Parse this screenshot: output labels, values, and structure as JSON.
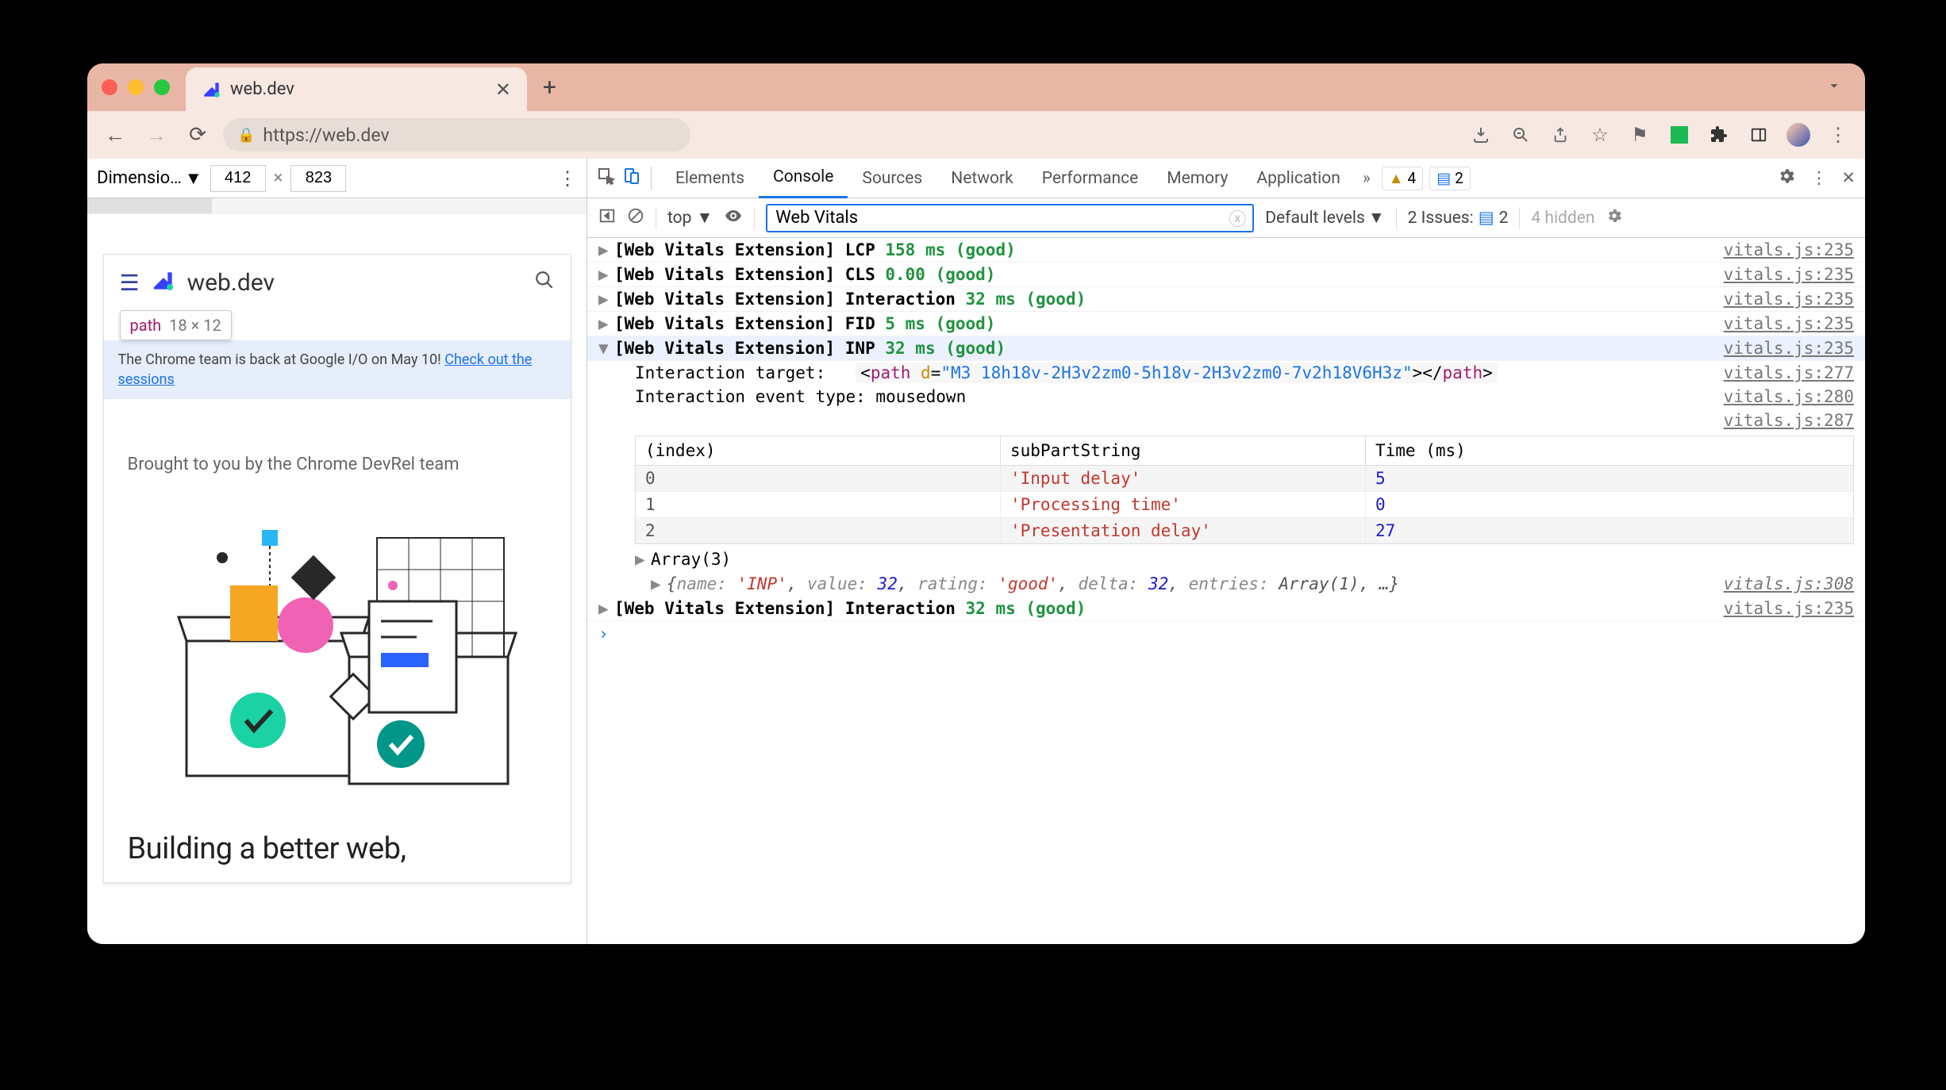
{
  "browser": {
    "tab_title": "web.dev",
    "url": "https://web.dev"
  },
  "device_toolbar": {
    "label": "Dimensio…",
    "width": "412",
    "height": "823",
    "x": "×"
  },
  "element_tooltip": {
    "name": "path",
    "dims": "18 × 12"
  },
  "page": {
    "logo": "web.dev",
    "banner_pre": "The Chrome team is back at Google I/O on May 10! ",
    "banner_link": "Check out the sessions",
    "subtitle": "Brought to you by the Chrome DevRel team",
    "headline": "Building a better web,"
  },
  "devtools": {
    "tabs": [
      "Elements",
      "Console",
      "Sources",
      "Network",
      "Performance",
      "Memory",
      "Application"
    ],
    "active_tab": "Console",
    "warn_count": "4",
    "msg_count": "2"
  },
  "console_toolbar": {
    "context": "top",
    "filter": "Web Vitals",
    "levels": "Default levels",
    "issues_label": "2 Issues:",
    "issues_count": "2",
    "hidden": "4 hidden"
  },
  "logs": [
    {
      "prefix": "[Web Vitals Extension]",
      "metric": "LCP",
      "value": "158 ms (good)",
      "src": "vitals.js:235"
    },
    {
      "prefix": "[Web Vitals Extension]",
      "metric": "CLS",
      "value": "0.00 (good)",
      "src": "vitals.js:235"
    },
    {
      "prefix": "[Web Vitals Extension]",
      "metric": "Interaction",
      "value": "32 ms (good)",
      "src": "vitals.js:235"
    },
    {
      "prefix": "[Web Vitals Extension]",
      "metric": "FID",
      "value": "5 ms (good)",
      "src": "vitals.js:235"
    },
    {
      "prefix": "[Web Vitals Extension]",
      "metric": "INP",
      "value": "32 ms (good)",
      "src": "vitals.js:235"
    }
  ],
  "detail": {
    "target_label": "Interaction target:",
    "target_tag": "path",
    "target_attr": "d",
    "target_attr_val": "\"M3 18h18v-2H3v2zm0-5h18v-2H3v2zm0-7v2h18V6H3z\"",
    "target_src": "vitals.js:277",
    "event_label": "Interaction event type:",
    "event_value": "mousedown",
    "event_src": "vitals.js:280",
    "table_src": "vitals.js:287"
  },
  "table": {
    "headers": [
      "(index)",
      "subPartString",
      "Time (ms)"
    ],
    "rows": [
      {
        "i": "0",
        "s": "'Input delay'",
        "t": "5"
      },
      {
        "i": "1",
        "s": "'Processing time'",
        "t": "0"
      },
      {
        "i": "2",
        "s": "'Presentation delay'",
        "t": "27"
      }
    ],
    "summary": "Array(3)"
  },
  "obj": {
    "text_pre": "{",
    "name_k": "name:",
    "name_v": "'INP'",
    "value_k": "value:",
    "value_v": "32",
    "rating_k": "rating:",
    "rating_v": "'good'",
    "delta_k": "delta:",
    "delta_v": "32",
    "entries_k": "entries:",
    "entries_v": "Array(1)",
    "tail": ", …}",
    "src": "vitals.js:308"
  },
  "log_after": {
    "prefix": "[Web Vitals Extension]",
    "metric": "Interaction",
    "value": "32 ms (good)",
    "src": "vitals.js:235"
  }
}
